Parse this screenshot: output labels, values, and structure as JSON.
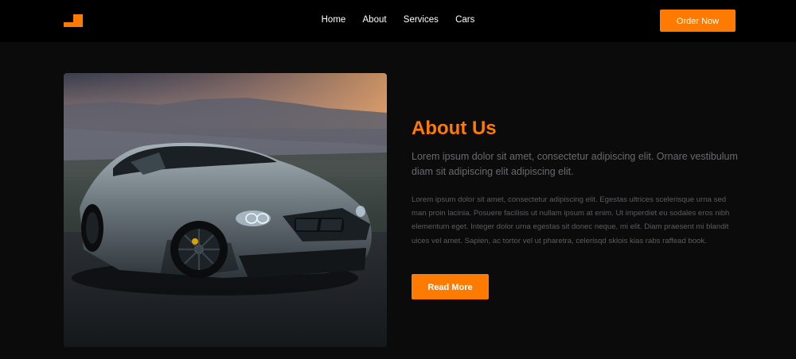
{
  "nav": {
    "logo_icon": "orange-corner-logo",
    "links": [
      "Home",
      "About",
      "Services",
      "Cars"
    ],
    "cta_label": "Order Now"
  },
  "hero_image": {
    "icon": "sports-car-photo"
  },
  "about": {
    "title": "About Us",
    "lead": "Lorem ipsum dolor sit amet, consectetur adipiscing elit. Ornare vestibulum diam sit adipiscing elit adipiscing elit.",
    "body": "Lorem ipsum dolor sit amet, consectetur adipiscing elit. Egestas ultrices scelerisque urna sed man proin lacinia. Posuere facilisis ut nullam ipsum at enim. Ut imperdiet eu sodales eros nibh elementum eget. Integer dolor urna egestas sit donec neque, mi elit. Diam praesent mi blandit uices vel amet. Sapien, ac tortor vel ut pharetra, celerisqd sklois kias rabs raffead book.",
    "button_label": "Read More"
  },
  "colors": {
    "accent": "#ff7a00",
    "background": "#0b0b0c",
    "navbar": "#000000"
  }
}
